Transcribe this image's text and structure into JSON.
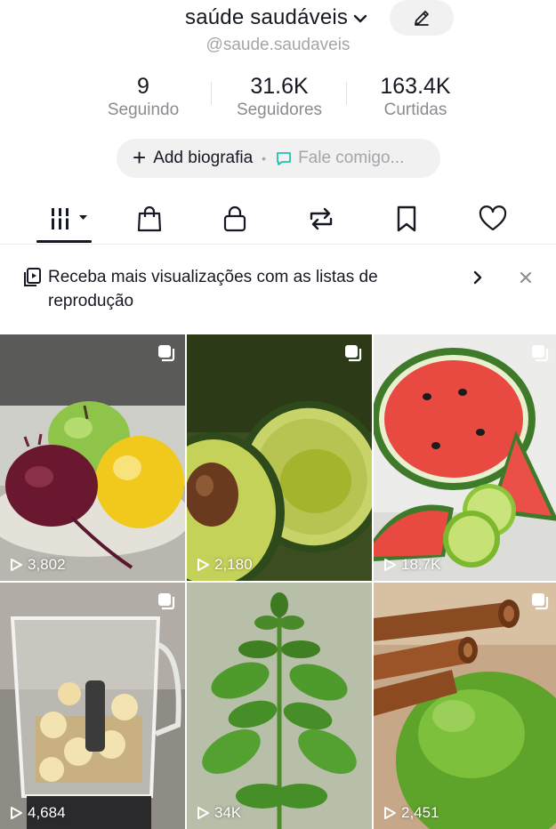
{
  "profile": {
    "name": "saúde saudáveis",
    "handle": "@saude.saudaveis"
  },
  "stats": [
    {
      "value": "9",
      "label": "Seguindo"
    },
    {
      "value": "31.6K",
      "label": "Seguidores"
    },
    {
      "value": "163.4K",
      "label": "Curtidas"
    }
  ],
  "bio": {
    "add_label": "Add biografia",
    "contact_label": "Fale comigo..."
  },
  "tabs": [
    {
      "icon": "videos-grid-icon",
      "active": true
    },
    {
      "icon": "shop-bag-icon"
    },
    {
      "icon": "lock-icon"
    },
    {
      "icon": "repost-icon"
    },
    {
      "icon": "bookmark-icon"
    },
    {
      "icon": "heart-icon"
    }
  ],
  "banner": {
    "text": "Receba mais visualizações com as listas de reprodução"
  },
  "videos": [
    {
      "views": "3,802",
      "subject": "apple lemon beet"
    },
    {
      "views": "2,180",
      "subject": "avocado"
    },
    {
      "views": "18.7K",
      "subject": "watermelon lime"
    },
    {
      "views": "4,684",
      "subject": "blender banana oats"
    },
    {
      "views": "34K",
      "subject": "basil plant"
    },
    {
      "views": "2,451",
      "subject": "cinnamon lime"
    }
  ],
  "colors": {
    "text": "#161823",
    "muted": "#8a8b91",
    "pill": "#f1f1f2"
  }
}
